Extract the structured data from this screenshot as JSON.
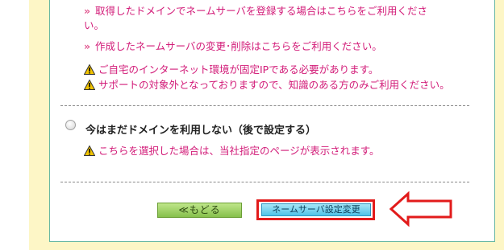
{
  "options": {
    "register_line1": "取得したドメインでネームサーバを登録する場合はこちらをご利用くださ",
    "register_line2": "い。",
    "change_delete": "作成したネームサーバの変更･削除はこちらをご利用ください。",
    "warning_fixed_ip": "ご自宅のインターネット環境が固定IPである必要があります。",
    "warning_support": "サポートの対象外となっておりますので、知識のある方のみご利用ください。"
  },
  "later_option": {
    "label": "今はまだドメインを利用しない（後で設定する）",
    "note": "こちらを選択した場合は、当社指定のページが表示されます。"
  },
  "buttons": {
    "back": "≪もどる",
    "nameserver_change": "ネームサーバ設定変更"
  },
  "colors": {
    "accent_pink": "#d21b78",
    "highlight_red": "#e21b1b",
    "page_bg": "#fdf6c6"
  }
}
